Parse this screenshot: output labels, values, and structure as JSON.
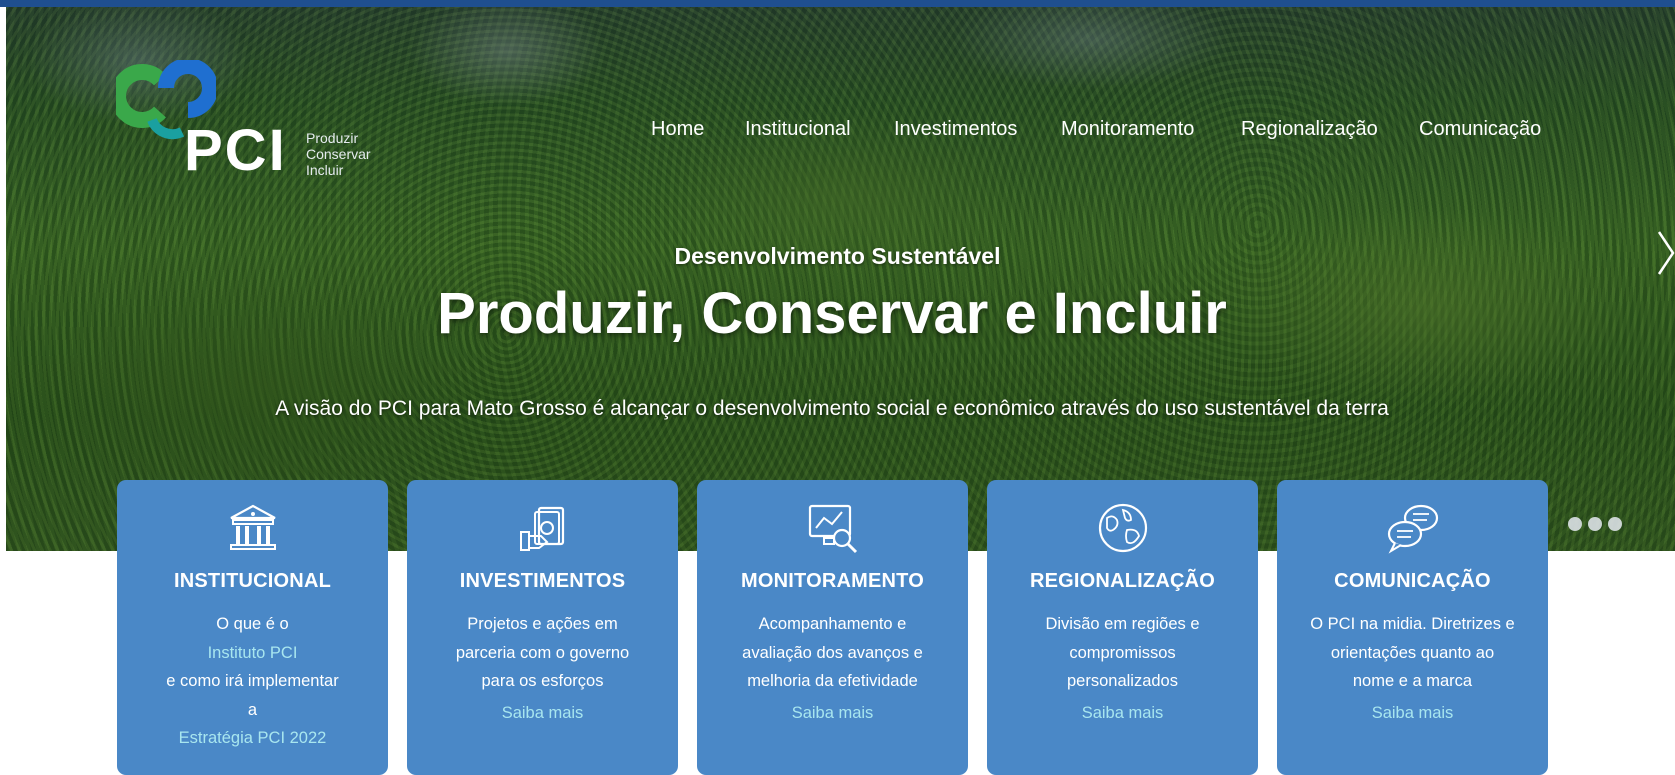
{
  "logo": {
    "letters": "PCI",
    "tagline": [
      "Produzir",
      "Conservar",
      "Incluir"
    ]
  },
  "nav": {
    "items": [
      "Home",
      "Institucional",
      "Investimentos",
      "Monitoramento",
      "Regionalização",
      "Comunicação"
    ]
  },
  "hero": {
    "subtitle": "Desenvolvimento Sustentável",
    "title": "Produzir, Conservar e Incluir",
    "description": "A visão do PCI para Mato Grosso é alcançar o desenvolvimento social e econômico através do uso sustentável da terra"
  },
  "cards": [
    {
      "icon": "bank-building-icon",
      "title": "INSTITUCIONAL",
      "lines": [
        "O que é o"
      ],
      "link1": "Instituto PCI",
      "lines2": [
        "e como irá implementar",
        "a"
      ],
      "link2": "Estratégia PCI 2022"
    },
    {
      "icon": "money-hand-icon",
      "title": "INVESTIMENTOS",
      "lines": [
        "Projetos e ações em",
        "parceria com o governo",
        "para os esforços"
      ],
      "more": "Saiba mais"
    },
    {
      "icon": "monitor-magnifier-icon",
      "title": "MONITORAMENTO",
      "lines": [
        "Acompanhamento e",
        "avaliação dos avanços e",
        "melhoria da efetividade"
      ],
      "more": "Saiba mais"
    },
    {
      "icon": "globe-icon",
      "title": "REGIONALIZAÇÃO",
      "lines": [
        "Divisão em regiões e",
        "compromissos",
        "personalizados"
      ],
      "more": "Saiba mais"
    },
    {
      "icon": "chat-bubbles-icon",
      "title": "COMUNICAÇÃO",
      "lines": [
        "O PCI na midia. Diretrizes e",
        "orientações quanto ao",
        "nome e a marca"
      ],
      "more": "Saiba mais"
    }
  ],
  "colors": {
    "card_bg": "#4a88c7",
    "link": "#a8e6ef",
    "top_bar": "#1f4f8f"
  }
}
